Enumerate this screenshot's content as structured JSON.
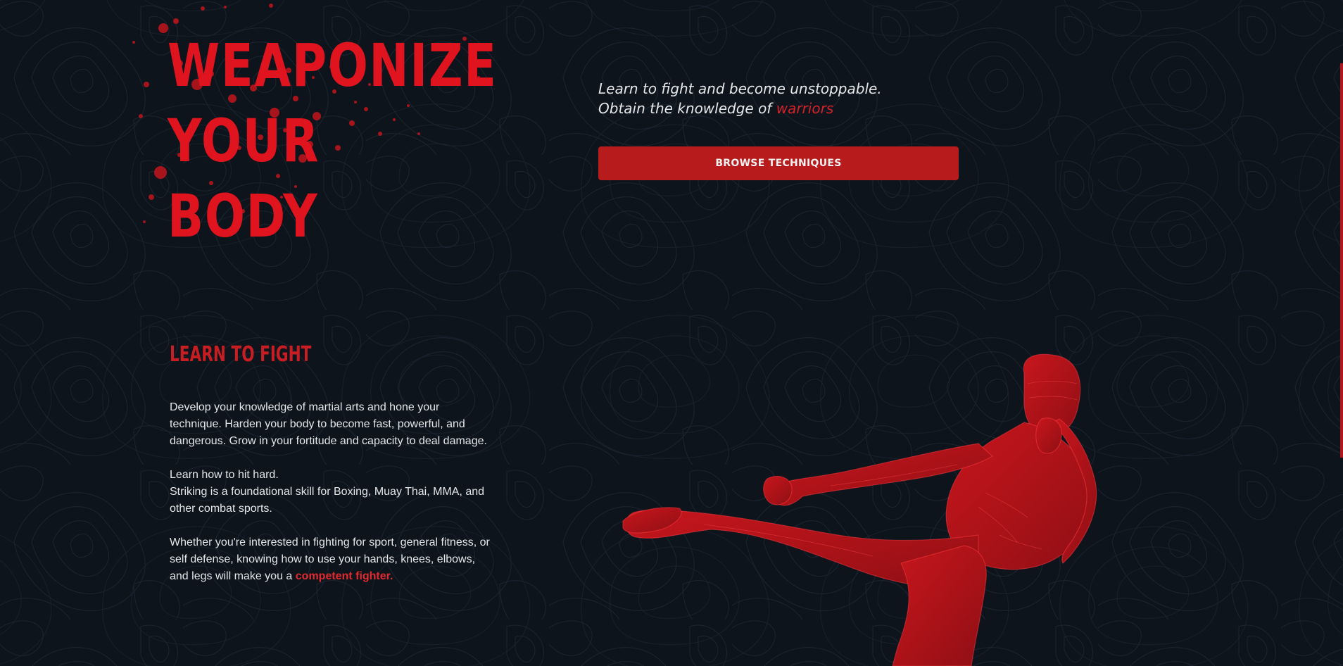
{
  "hero": {
    "title_line_1": "WEAPONIZE",
    "title_line_2": "YOUR",
    "title_line_3": "BODY"
  },
  "tagline": {
    "line_1": "Learn to fight and become unstoppable.",
    "line_2_prefix": "Obtain the knowledge of ",
    "line_2_accent": "warriors"
  },
  "cta": {
    "browse_label": "BROWSE TECHNIQUES"
  },
  "section": {
    "title": "LEARN TO FIGHT",
    "paragraph_1": "Develop your knowledge of martial arts and hone your technique. Harden your body to become fast, powerful, and dangerous. Grow in your fortitude and capacity to deal damage.",
    "paragraph_2_line_1": "Learn how to hit hard.",
    "paragraph_2_line_2": "Striking is a foundational skill for Boxing, Muay Thai, MMA, and other combat sports.",
    "paragraph_3_prefix": "Whether you're interested in fighting for sport, general fitness, or self defense, knowing how to use your hands, knees, elbows, and legs will make you a ",
    "paragraph_3_accent": "competent fighter."
  },
  "colors": {
    "background": "#0d141c",
    "accent_red": "#e0141f",
    "button_red": "#b81b1c",
    "text": "#e4e6e8"
  },
  "icons": {
    "topographic_background": "topographic-contour-pattern",
    "blood_splatter": "blood-splatter",
    "fighter_illustration": "kicking-fighter-figure"
  }
}
